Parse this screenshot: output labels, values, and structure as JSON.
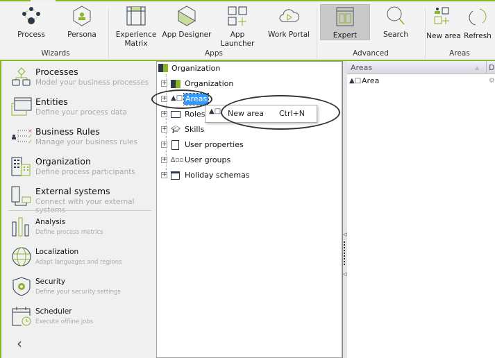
{
  "ribbon": {
    "groups": [
      {
        "label": "Wizards"
      },
      {
        "label": "Apps"
      },
      {
        "label": "Advanced"
      },
      {
        "label": "Areas"
      }
    ],
    "buttons": {
      "process": "Process",
      "persona": "Persona",
      "experience_matrix": "Experience Matrix",
      "app_designer": "App Designer",
      "app_launcher": "App Launcher",
      "work_portal": "Work Portal",
      "expert": "Expert",
      "search": "Search",
      "new_area": "New area",
      "refresh": "Refresh"
    },
    "selected": "Expert"
  },
  "sidebar": {
    "items": [
      {
        "title": "Processes",
        "desc": "Model your business processes"
      },
      {
        "title": "Entities",
        "desc": "Define your process data"
      },
      {
        "title": "Business Rules",
        "desc": "Manage your business rules"
      },
      {
        "title": "Organization",
        "desc": "Define process participants"
      },
      {
        "title": "External systems",
        "desc": "Connect with your external systems"
      },
      {
        "title": "Analysis",
        "desc": "Define process metrics"
      },
      {
        "title": "Localization",
        "desc": "Adapt languages and regions"
      },
      {
        "title": "Security",
        "desc": "Define your security settings"
      },
      {
        "title": "Scheduler",
        "desc": "Execute offline jobs"
      }
    ],
    "collapse": "‹"
  },
  "tree": {
    "root": "Organization",
    "children": [
      "Organization",
      "Areas",
      "Roles",
      "Skills",
      "User properties",
      "User groups",
      "Holiday schemas"
    ],
    "selected": "Areas"
  },
  "context_menu": {
    "item": "New area",
    "shortcut": "Ctrl+N"
  },
  "list": {
    "columns": [
      "Areas",
      "D"
    ],
    "rows": [
      "Area"
    ]
  },
  "colors": {
    "accent": "#8ab42a",
    "selection": "#3399ff"
  }
}
